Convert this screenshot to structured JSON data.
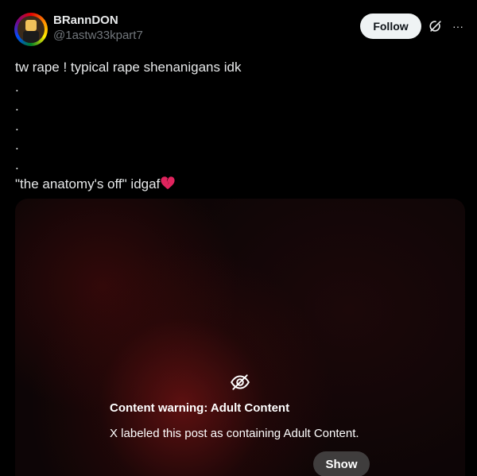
{
  "author": {
    "display_name": "BRannDON",
    "handle": "@1astw33kpart7"
  },
  "actions": {
    "follow_label": "Follow",
    "grok_icon": "grok-icon",
    "more_icon": "more-icon",
    "more_glyph": "···"
  },
  "post": {
    "lines": [
      "tw rape ! typical rape shenanigans idk",
      ".",
      ".",
      ".",
      ".",
      ".",
      "\"the anatomy's off\" idgaf"
    ],
    "emoji": "broken-heart-icon"
  },
  "media": {
    "warning_icon": "eye-slash-icon",
    "warning_title": "Content warning: Adult Content",
    "warning_text": "X labeled this post as containing Adult Content.",
    "show_label": "Show"
  },
  "colors": {
    "background": "#000000",
    "text": "#e7e9ea",
    "secondary_text": "#71767b",
    "follow_bg": "#eff3f4",
    "emoji_red": "#e0245e"
  }
}
